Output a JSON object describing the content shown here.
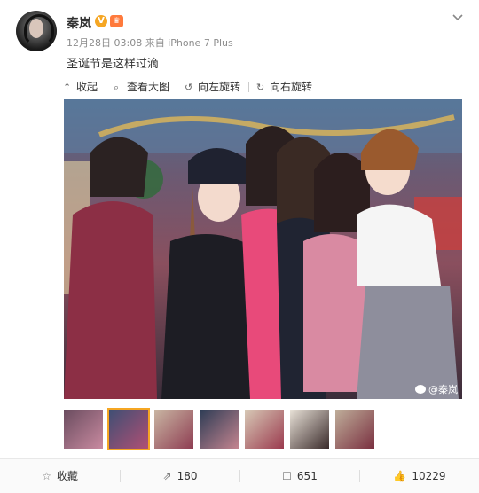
{
  "author": {
    "name": "秦岚",
    "verified_mark": "V"
  },
  "post": {
    "date": "12月28日 03:08",
    "source": "来自 iPhone 7 Plus",
    "text": "圣诞节是这样过滴"
  },
  "toolbar": {
    "collapse": "收起",
    "view_large": "查看大图",
    "rotate_left": "向左旋转",
    "rotate_right": "向右旋转"
  },
  "photo": {
    "watermark": "@秦岚"
  },
  "thumbnails": {
    "count": 7,
    "selected_index": 1
  },
  "actions": {
    "favorite": "收藏",
    "repost": "180",
    "comment": "651",
    "like": "10229"
  },
  "colors": {
    "accent": "#f5a623",
    "muted": "#8c8c8c"
  },
  "icons": [
    "chevron-down-icon",
    "collapse-icon",
    "search-icon",
    "rotate-left-icon",
    "rotate-right-icon",
    "star-icon",
    "repost-icon",
    "comment-icon",
    "like-icon",
    "weibo-logo-icon"
  ]
}
